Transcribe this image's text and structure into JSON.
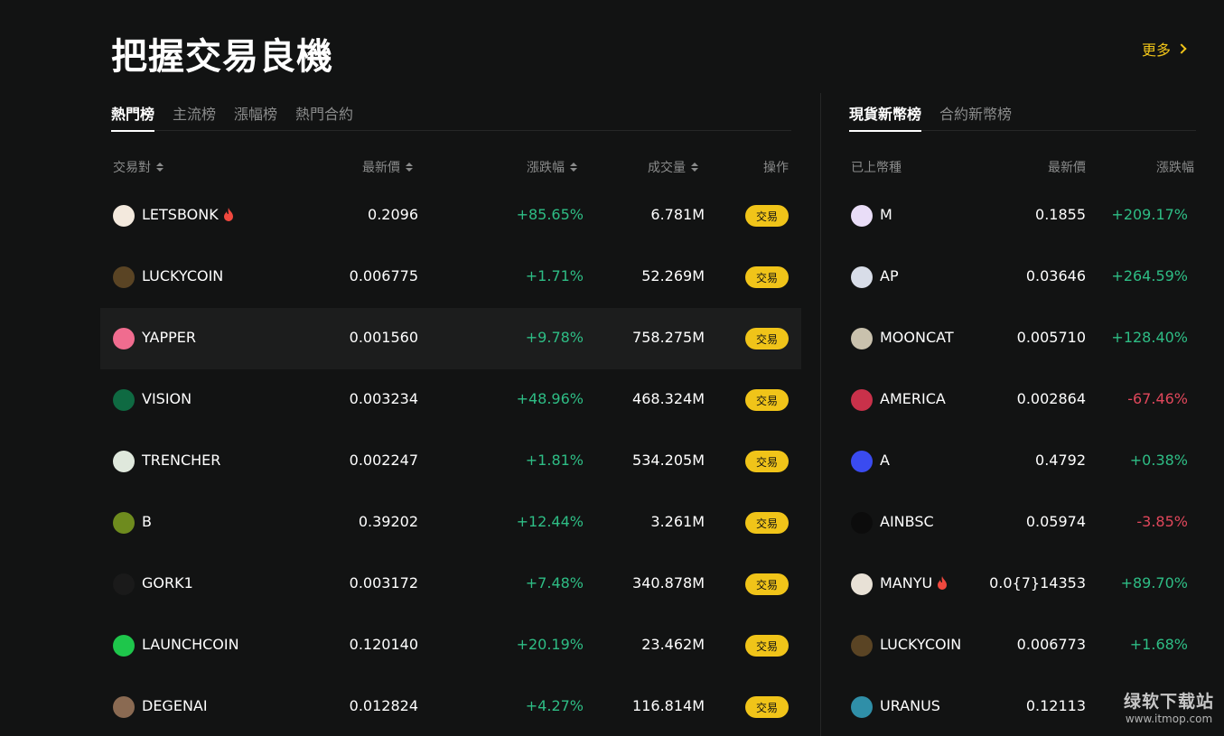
{
  "page": {
    "title": "把握交易良機",
    "more_label": "更多"
  },
  "left_panel": {
    "tabs": [
      "熱門榜",
      "主流榜",
      "漲幅榜",
      "熱門合約"
    ],
    "active_tab": 0,
    "headers": {
      "pair": "交易對",
      "price": "最新價",
      "change": "漲跌幅",
      "volume": "成交量",
      "action": "操作"
    },
    "trade_label": "交易",
    "rows": [
      {
        "name": "LETSBONK",
        "hot": true,
        "price": "0.2096",
        "change": "+85.65%",
        "dir": "up",
        "volume": "6.781M",
        "icon": "letsbonk-icon",
        "color": "#f3e9dd"
      },
      {
        "name": "LUCKYCOIN",
        "hot": false,
        "price": "0.006775",
        "change": "+1.71%",
        "dir": "up",
        "volume": "52.269M",
        "icon": "luckycoin-icon",
        "color": "#5a4424"
      },
      {
        "name": "YAPPER",
        "hot": false,
        "price": "0.001560",
        "change": "+9.78%",
        "dir": "up",
        "volume": "758.275M",
        "icon": "yapper-icon",
        "color": "#f06c8f"
      },
      {
        "name": "VISION",
        "hot": false,
        "price": "0.003234",
        "change": "+48.96%",
        "dir": "up",
        "volume": "468.324M",
        "icon": "vision-icon",
        "color": "#0f6a42"
      },
      {
        "name": "TRENCHER",
        "hot": false,
        "price": "0.002247",
        "change": "+1.81%",
        "dir": "up",
        "volume": "534.205M",
        "icon": "trencher-icon",
        "color": "#dfe8dc"
      },
      {
        "name": "B",
        "hot": false,
        "price": "0.39202",
        "change": "+12.44%",
        "dir": "up",
        "volume": "3.261M",
        "icon": "b-icon",
        "color": "#6e8b1e"
      },
      {
        "name": "GORK1",
        "hot": false,
        "price": "0.003172",
        "change": "+7.48%",
        "dir": "up",
        "volume": "340.878M",
        "icon": "gork1-icon",
        "color": "#1a1a1a"
      },
      {
        "name": "LAUNCHCOIN",
        "hot": false,
        "price": "0.120140",
        "change": "+20.19%",
        "dir": "up",
        "volume": "23.462M",
        "icon": "launchcoin-icon",
        "color": "#1ec64b"
      },
      {
        "name": "DEGENAI",
        "hot": false,
        "price": "0.012824",
        "change": "+4.27%",
        "dir": "up",
        "volume": "116.814M",
        "icon": "degenai-icon",
        "color": "#8a6a52"
      }
    ]
  },
  "right_panel": {
    "tabs": [
      "現貨新幣榜",
      "合約新幣榜"
    ],
    "active_tab": 0,
    "headers": {
      "coin": "已上幣種",
      "price": "最新價",
      "change": "漲跌幅"
    },
    "rows": [
      {
        "name": "M",
        "hot": false,
        "price": "0.1855",
        "change": "+209.17%",
        "dir": "up",
        "icon": "m-icon",
        "color": "#e9ddf7"
      },
      {
        "name": "AP",
        "hot": false,
        "price": "0.03646",
        "change": "+264.59%",
        "dir": "up",
        "icon": "ap-icon",
        "color": "#d8dde8"
      },
      {
        "name": "MOONCAT",
        "hot": false,
        "price": "0.005710",
        "change": "+128.40%",
        "dir": "up",
        "icon": "mooncat-icon",
        "color": "#c9c1ad"
      },
      {
        "name": "AMERICA",
        "hot": false,
        "price": "0.002864",
        "change": "-67.46%",
        "dir": "down",
        "icon": "america-flag-icon",
        "color": "#c9314a"
      },
      {
        "name": "A",
        "hot": false,
        "price": "0.4792",
        "change": "+0.38%",
        "dir": "up",
        "icon": "a-icon",
        "color": "#3a4bf0"
      },
      {
        "name": "AINBSC",
        "hot": false,
        "price": "0.05974",
        "change": "-3.85%",
        "dir": "down",
        "icon": "ainbsc-icon",
        "color": "#0c0c0c"
      },
      {
        "name": "MANYU",
        "hot": true,
        "price": "0.0{7}14353",
        "change": "+89.70%",
        "dir": "up",
        "icon": "manyu-icon",
        "color": "#e8e1d6"
      },
      {
        "name": "LUCKYCOIN",
        "hot": false,
        "price": "0.006773",
        "change": "+1.68%",
        "dir": "up",
        "icon": "luckycoin-icon",
        "color": "#5a4424"
      },
      {
        "name": "URANUS",
        "hot": false,
        "price": "0.12113",
        "change": "",
        "dir": "up",
        "icon": "uranus-icon",
        "color": "#2f8fa8"
      }
    ]
  },
  "watermark": {
    "line1": "绿软下载站",
    "line2": "www.itmop.com"
  },
  "colors": {
    "accent": "#f0c419",
    "up": "#2ebd85",
    "down": "#e0475b",
    "background": "#121313"
  }
}
